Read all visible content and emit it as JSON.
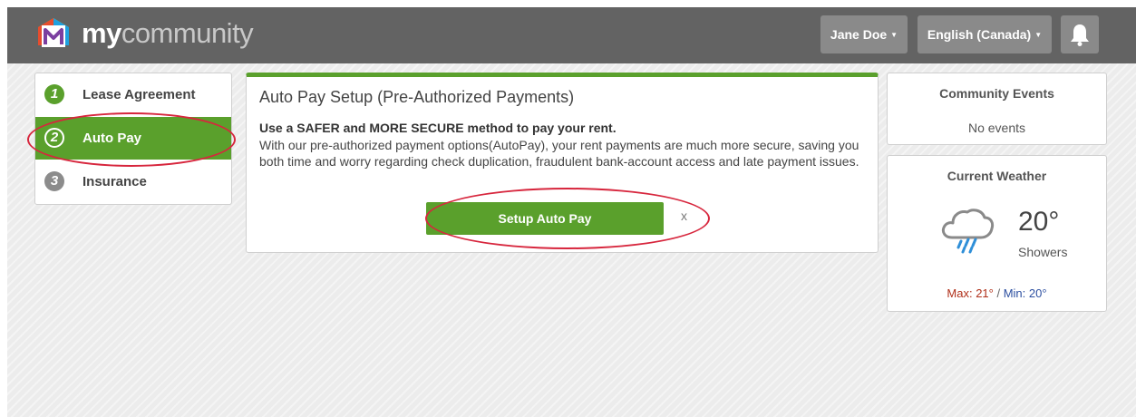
{
  "header": {
    "brand_bold": "my",
    "brand_light": "community",
    "user_menu": "Jane Doe",
    "language_menu": "English (Canada)",
    "icons": {
      "logo": "mycommunity-logo",
      "notifications": "bell-icon",
      "caret": "caret-down-icon"
    }
  },
  "steps": [
    {
      "number": "1",
      "label": "Lease Agreement",
      "state": "complete"
    },
    {
      "number": "2",
      "label": "Auto Pay",
      "state": "active"
    },
    {
      "number": "3",
      "label": "Insurance",
      "state": "pending"
    }
  ],
  "main": {
    "title": "Auto Pay Setup (Pre-Authorized Payments)",
    "lead": "Use a SAFER and MORE SECURE method to pay your rent.",
    "body": "With our pre-authorized payment options(AutoPay), your rent payments are much more secure, saving you both time and worry regarding check duplication, fraudulent bank-account access and late payment issues.",
    "setup_button": "Setup Auto Pay",
    "dismiss": "x"
  },
  "events": {
    "title": "Community Events",
    "empty_text": "No events"
  },
  "weather": {
    "title": "Current Weather",
    "temperature": "20°",
    "condition": "Showers",
    "max": "Max: 21°",
    "separator": " / ",
    "min": "Min: 20°",
    "icon": "cloud-rain-icon"
  },
  "colors": {
    "accent_green": "#5aa02c",
    "header_bg": "#636363",
    "annotation_red": "#d7263d",
    "max_red": "#b0301a",
    "min_blue": "#2c4fa0"
  }
}
